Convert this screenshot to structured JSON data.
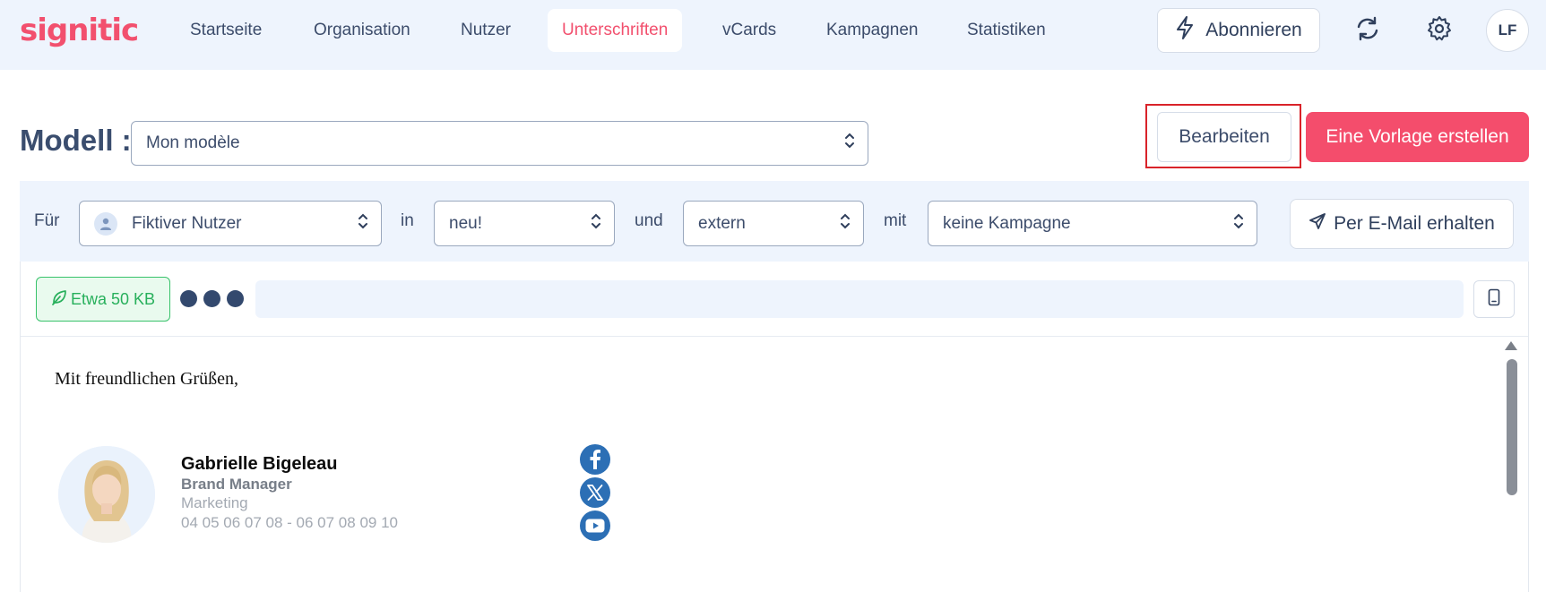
{
  "brand": {
    "logo_text": "signitic",
    "accent": "#f2506e"
  },
  "nav": {
    "items": [
      {
        "label": "Startseite"
      },
      {
        "label": "Organisation"
      },
      {
        "label": "Nutzer"
      },
      {
        "label": "Unterschriften",
        "active": true
      },
      {
        "label": "vCards"
      },
      {
        "label": "Kampagnen"
      },
      {
        "label": "Statistiken"
      }
    ],
    "subscribe_label": "Abonnieren",
    "subscribe_icon": "bolt-icon",
    "sync_icon": "sync-icon",
    "settings_icon": "gear-icon",
    "user_initials": "LF"
  },
  "model": {
    "label": "Modell :",
    "selected": "Mon modèle",
    "edit_label": "Bearbeiten",
    "create_label": "Eine Vorlage erstellen"
  },
  "filters": {
    "for_label": "Für",
    "user_value": "Fiktiver Nutzer",
    "in_label": "in",
    "group_value": "neu!",
    "and_label": "und",
    "type_value": "extern",
    "with_label": "mit",
    "campaign_value": "keine Kampagne",
    "email_label": "Per E-Mail erhalten"
  },
  "editor": {
    "size_badge": "Etwa 50 KB",
    "greeting": "Mit freundlichen Grüßen,",
    "signature": {
      "name": "Gabrielle Bigeleau",
      "title": "Brand Manager",
      "department": "Marketing",
      "phone": "04 05 06 07 08 - 06 07 08 09 10"
    },
    "social": [
      "facebook-icon",
      "x-icon",
      "youtube-icon"
    ]
  }
}
